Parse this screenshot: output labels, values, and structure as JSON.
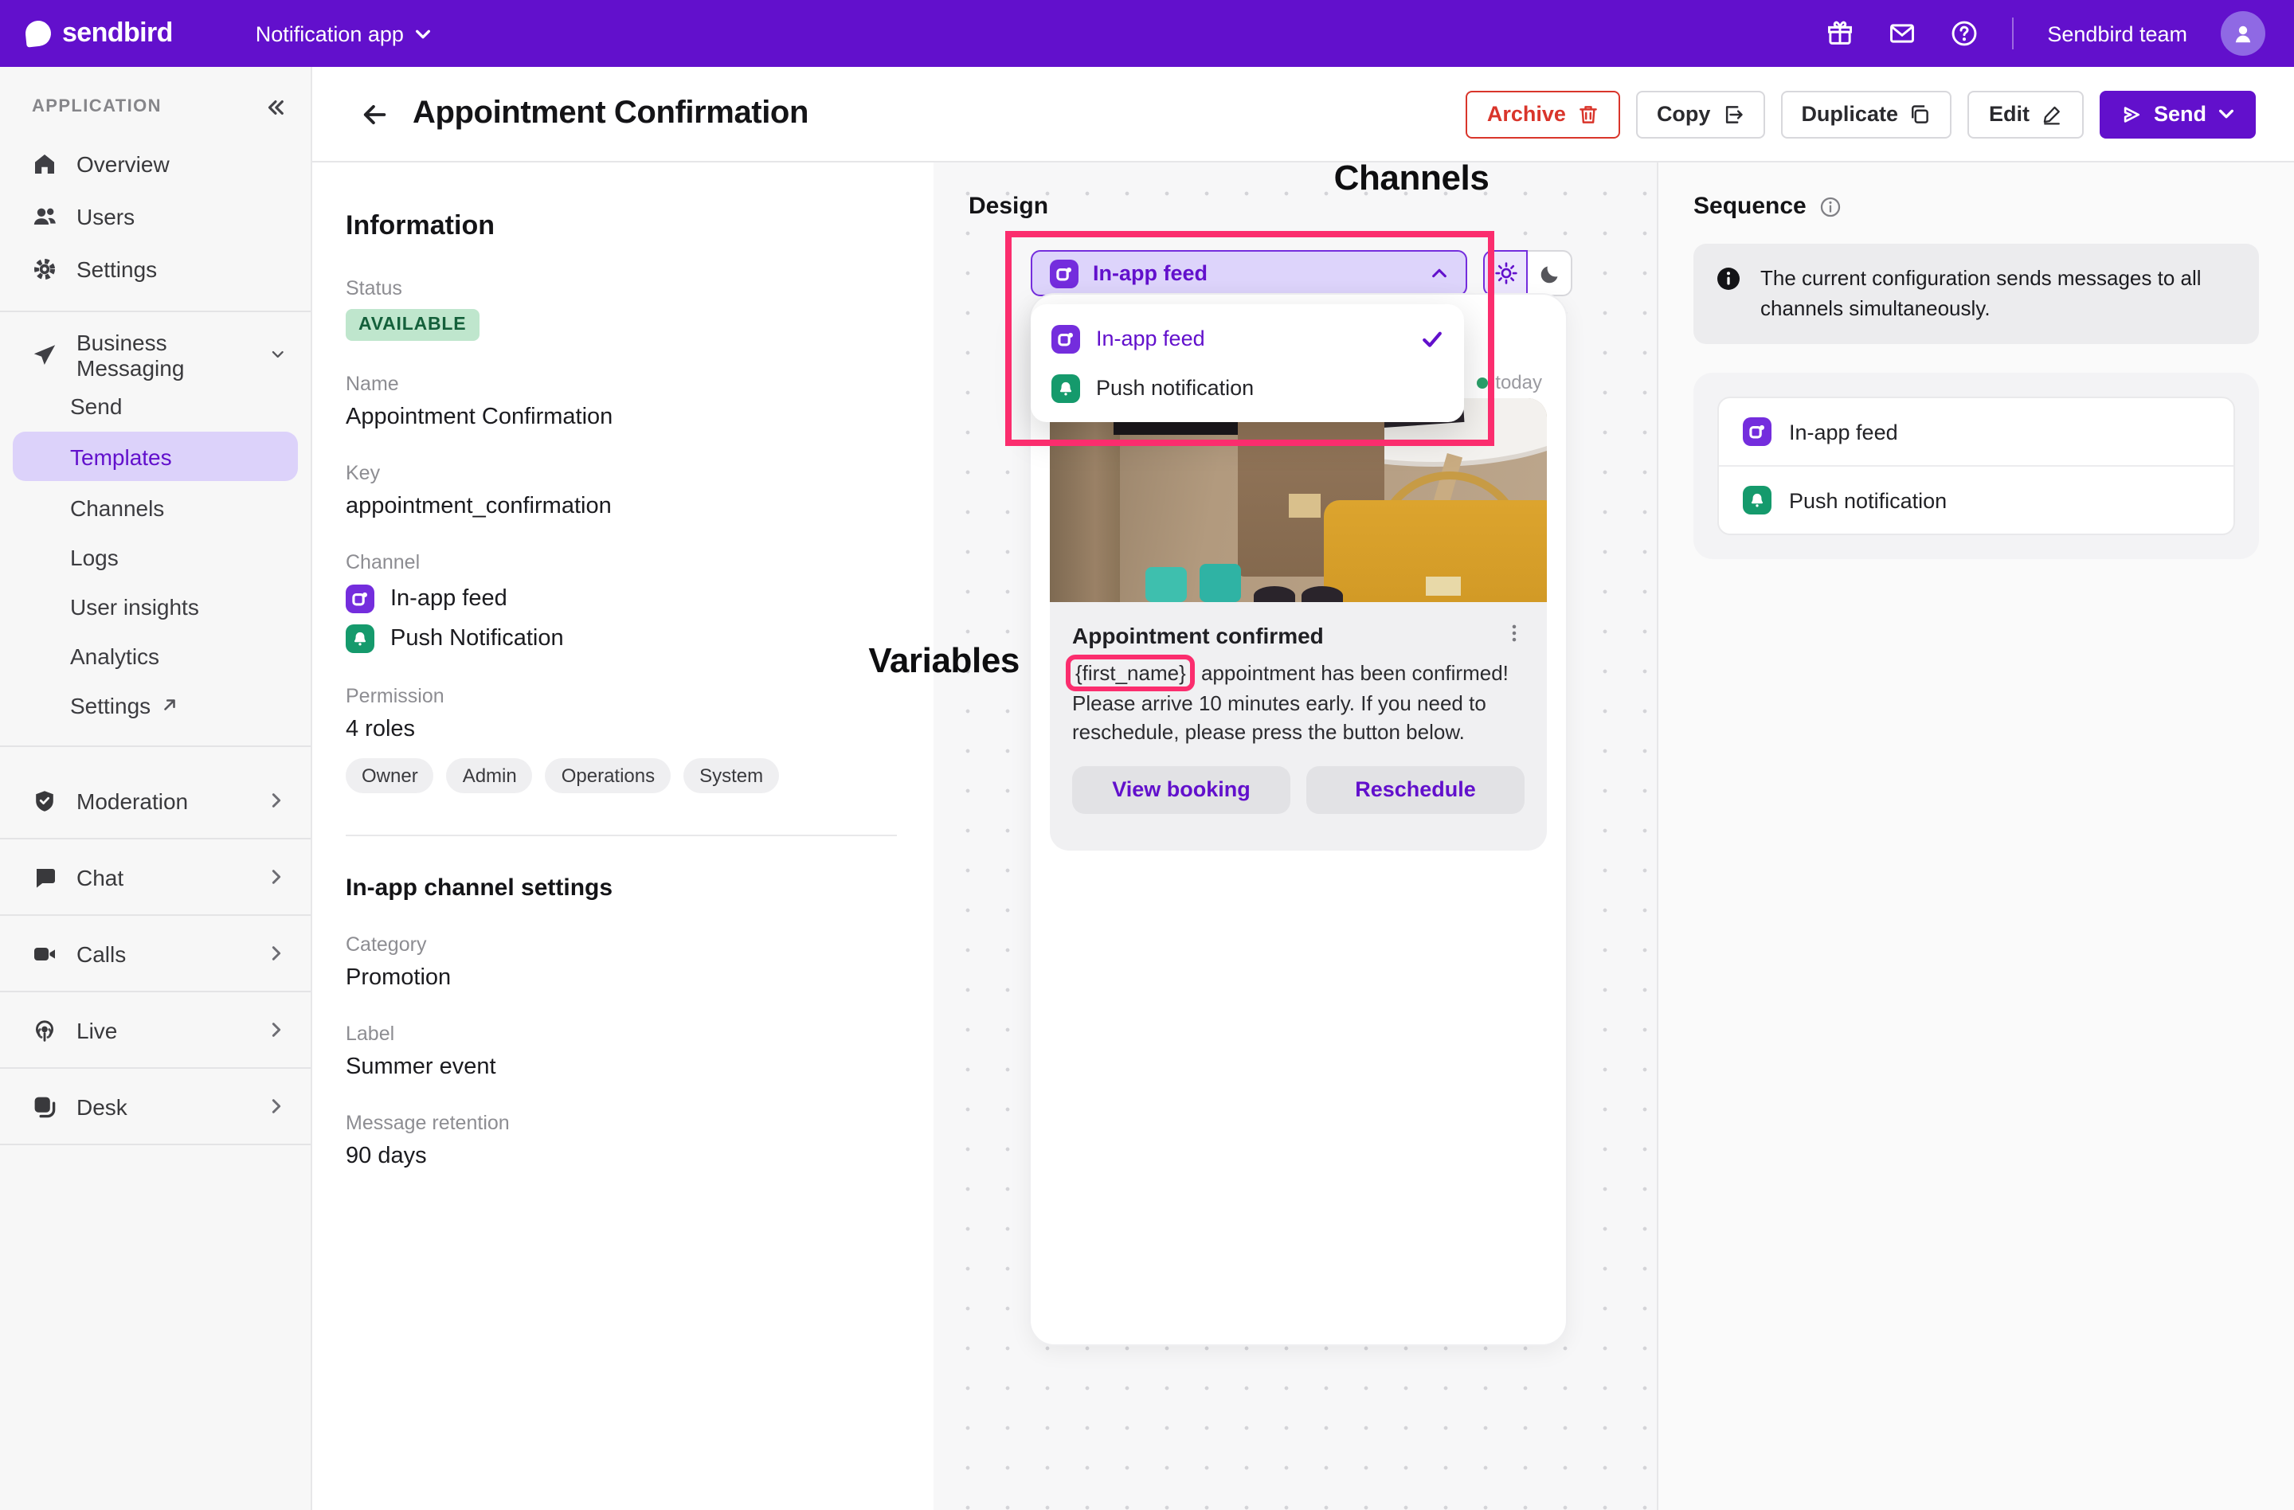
{
  "topbar": {
    "brand": "sendbird",
    "app_selector": "Notification app",
    "account": "Sendbird team"
  },
  "sidebar": {
    "section_label": "APPLICATION",
    "items": [
      {
        "label": "Overview"
      },
      {
        "label": "Users"
      },
      {
        "label": "Settings"
      }
    ],
    "business_messaging": {
      "label": "Business Messaging"
    },
    "bm_children": [
      {
        "label": "Send"
      },
      {
        "label": "Templates"
      },
      {
        "label": "Channels"
      },
      {
        "label": "Logs"
      },
      {
        "label": "User insights"
      },
      {
        "label": "Analytics"
      },
      {
        "label": "Settings"
      }
    ],
    "bottom_items": [
      {
        "label": "Moderation"
      },
      {
        "label": "Chat"
      },
      {
        "label": "Calls"
      },
      {
        "label": "Live"
      },
      {
        "label": "Desk"
      }
    ]
  },
  "header": {
    "title": "Appointment Confirmation",
    "archive": "Archive",
    "copy": "Copy",
    "duplicate": "Duplicate",
    "edit": "Edit",
    "send": "Send"
  },
  "information": {
    "title": "Information",
    "status_label": "Status",
    "status_value": "AVAILABLE",
    "name_label": "Name",
    "name_value": "Appointment Confirmation",
    "key_label": "Key",
    "key_value": "appointment_confirmation",
    "channel_label": "Channel",
    "channels": [
      {
        "label": "In-app feed"
      },
      {
        "label": "Push Notification"
      }
    ],
    "permission_label": "Permission",
    "permission_value": "4 roles",
    "roles": [
      {
        "label": "Owner"
      },
      {
        "label": "Admin"
      },
      {
        "label": "Operations"
      },
      {
        "label": "System"
      }
    ],
    "settings_title": "In-app channel settings",
    "category_label": "Category",
    "category_value": "Promotion",
    "label_label": "Label",
    "label_value": "Summer event",
    "retention_label": "Message retention",
    "retention_value": "90 days"
  },
  "design": {
    "panel_label": "Design",
    "selected_channel": "In-app feed",
    "menu": [
      {
        "label": "In-app feed"
      },
      {
        "label": "Push notification"
      }
    ],
    "date_label": "today",
    "card_title": "Appointment confirmed",
    "variable_token": "{first_name}",
    "body_rest": " appointment has been confirmed!",
    "body_line2": "Please arrive 10 minutes early. If you need to reschedule, please press the button below.",
    "view_booking": "View booking",
    "reschedule": "Reschedule"
  },
  "annotations": {
    "channels": "Channels",
    "variables": "Variables",
    "highlight_color": "#FB2D6E"
  },
  "sequence": {
    "title": "Sequence",
    "info": "The current configuration sends messages to all channels simultaneously.",
    "channels": [
      {
        "label": "In-app feed"
      },
      {
        "label": "Push notification"
      }
    ]
  },
  "colors": {
    "brand_purple": "#6210CC",
    "accent_purple": "#742DDD",
    "channel_green": "#159A6C",
    "annotation_pink": "#FB2D6E",
    "archive_red": "#D9352B",
    "status_badge_bg": "#BFE6CD",
    "status_badge_text": "#14603B"
  }
}
